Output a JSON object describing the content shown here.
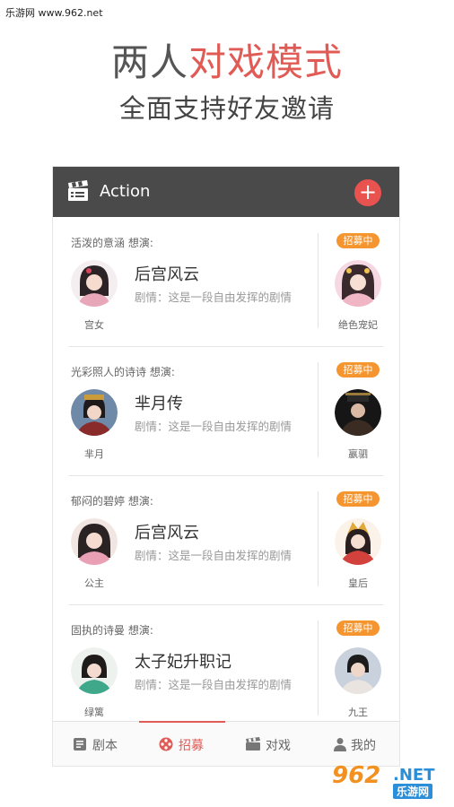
{
  "watermark": "乐游网 www.962.net",
  "promo": {
    "title_dark": "两人",
    "title_accent": "对戏模式",
    "subtitle": "全面支持好友邀请"
  },
  "appbar": {
    "title": "Action",
    "add_symbol": "+"
  },
  "cards": [
    {
      "who": "活泼的意涵 想演:",
      "left_name": "宫女",
      "drama": "后宫风云",
      "plot": "剧情：这是一段自由发挥的剧情",
      "badge": "招募中",
      "right_name": "绝色宠妃"
    },
    {
      "who": "光彩照人的诗诗 想演:",
      "left_name": "芈月",
      "drama": "芈月传",
      "plot": "剧情：这是一段自由发挥的剧情",
      "badge": "招募中",
      "right_name": "嬴驷"
    },
    {
      "who": "郁闷的碧婷 想演:",
      "left_name": "公主",
      "drama": "后宫风云",
      "plot": "剧情：这是一段自由发挥的剧情",
      "badge": "招募中",
      "right_name": "皇后"
    },
    {
      "who": "固执的诗曼 想演:",
      "left_name": "绿篱",
      "drama": "太子妃升职记",
      "plot": "剧情：这是一段自由发挥的剧情",
      "badge": "招募中",
      "right_name": "九王"
    }
  ],
  "tabs": [
    {
      "label": "剧本",
      "icon": "script-icon",
      "active": false
    },
    {
      "label": "招募",
      "icon": "film-reel-icon",
      "active": true
    },
    {
      "label": "对戏",
      "icon": "clapperboard-icon",
      "active": false
    },
    {
      "label": "我的",
      "icon": "person-icon",
      "active": false
    }
  ],
  "colors": {
    "accent": "#e05b55",
    "badge": "#f5952f",
    "appbar": "#4a4a4a"
  },
  "brand": {
    "number": "962",
    "domain": ".NET",
    "name": "乐游网"
  }
}
